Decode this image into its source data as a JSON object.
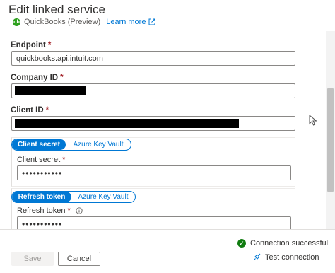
{
  "header": {
    "title": "Edit linked service",
    "service_name": "QuickBooks (Preview)",
    "learn_more": "Learn more"
  },
  "form": {
    "endpoint": {
      "label": "Endpoint",
      "required_mark": "*",
      "value": "quickbooks.api.intuit.com"
    },
    "company_id": {
      "label": "Company ID",
      "required_mark": "*",
      "value": ""
    },
    "client_id": {
      "label": "Client ID",
      "required_mark": "*",
      "value": ""
    },
    "client_secret_group": {
      "toggle": {
        "options": [
          "Client secret",
          "Azure Key Vault"
        ],
        "selected": "Client secret"
      },
      "label": "Client secret",
      "required_mark": "*",
      "value": "•••••••••••"
    },
    "refresh_token_group": {
      "toggle": {
        "options": [
          "Refresh token",
          "Azure Key Vault"
        ],
        "selected": "Refresh token"
      },
      "label": "Refresh token",
      "required_mark": "*",
      "value": "•••••••••••"
    }
  },
  "footer": {
    "status": "Connection successful",
    "test_connection": "Test connection",
    "save_label": "Save",
    "cancel_label": "Cancel"
  },
  "icons": {
    "service": "quickbooks-icon",
    "external_link": "external-link-icon",
    "info": "info-icon",
    "status": "checkmark-circle-icon",
    "test": "plug-icon"
  },
  "colors": {
    "accent": "#0078d4",
    "success": "#107c10",
    "required": "#a4262c",
    "quickbooks": "#2ca01c"
  }
}
